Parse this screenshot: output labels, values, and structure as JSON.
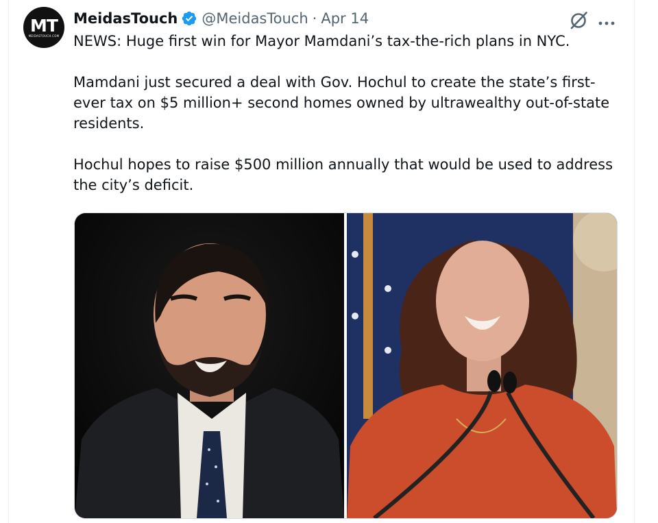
{
  "tweet": {
    "author": {
      "display_name": "MeidasTouch",
      "handle": "@MeidasTouch",
      "verified": true,
      "avatar": {
        "monogram": "MT",
        "subtext": "MEIDASTOUCH.COM"
      }
    },
    "separator": "·",
    "date": "Apr 14",
    "text": "NEWS: Huge first win for Mayor Mamdani’s tax-the-rich plans in NYC.\n\nMamdani just secured a deal with Gov. Hochul to create the state’s first-ever tax on $5 million+ second homes owned by ultrawealthy out-of-state residents.\n\nHochul hopes to raise $500 million annually that would be used to address the city’s deficit.",
    "icons": {
      "grok": "grok-icon",
      "more": "more-icon",
      "verified": "verified-badge-icon"
    }
  },
  "colors": {
    "text_primary": "#0f1419",
    "text_secondary": "#536471",
    "verified_blue": "#1d9bf0",
    "border": "#cfd9de"
  }
}
